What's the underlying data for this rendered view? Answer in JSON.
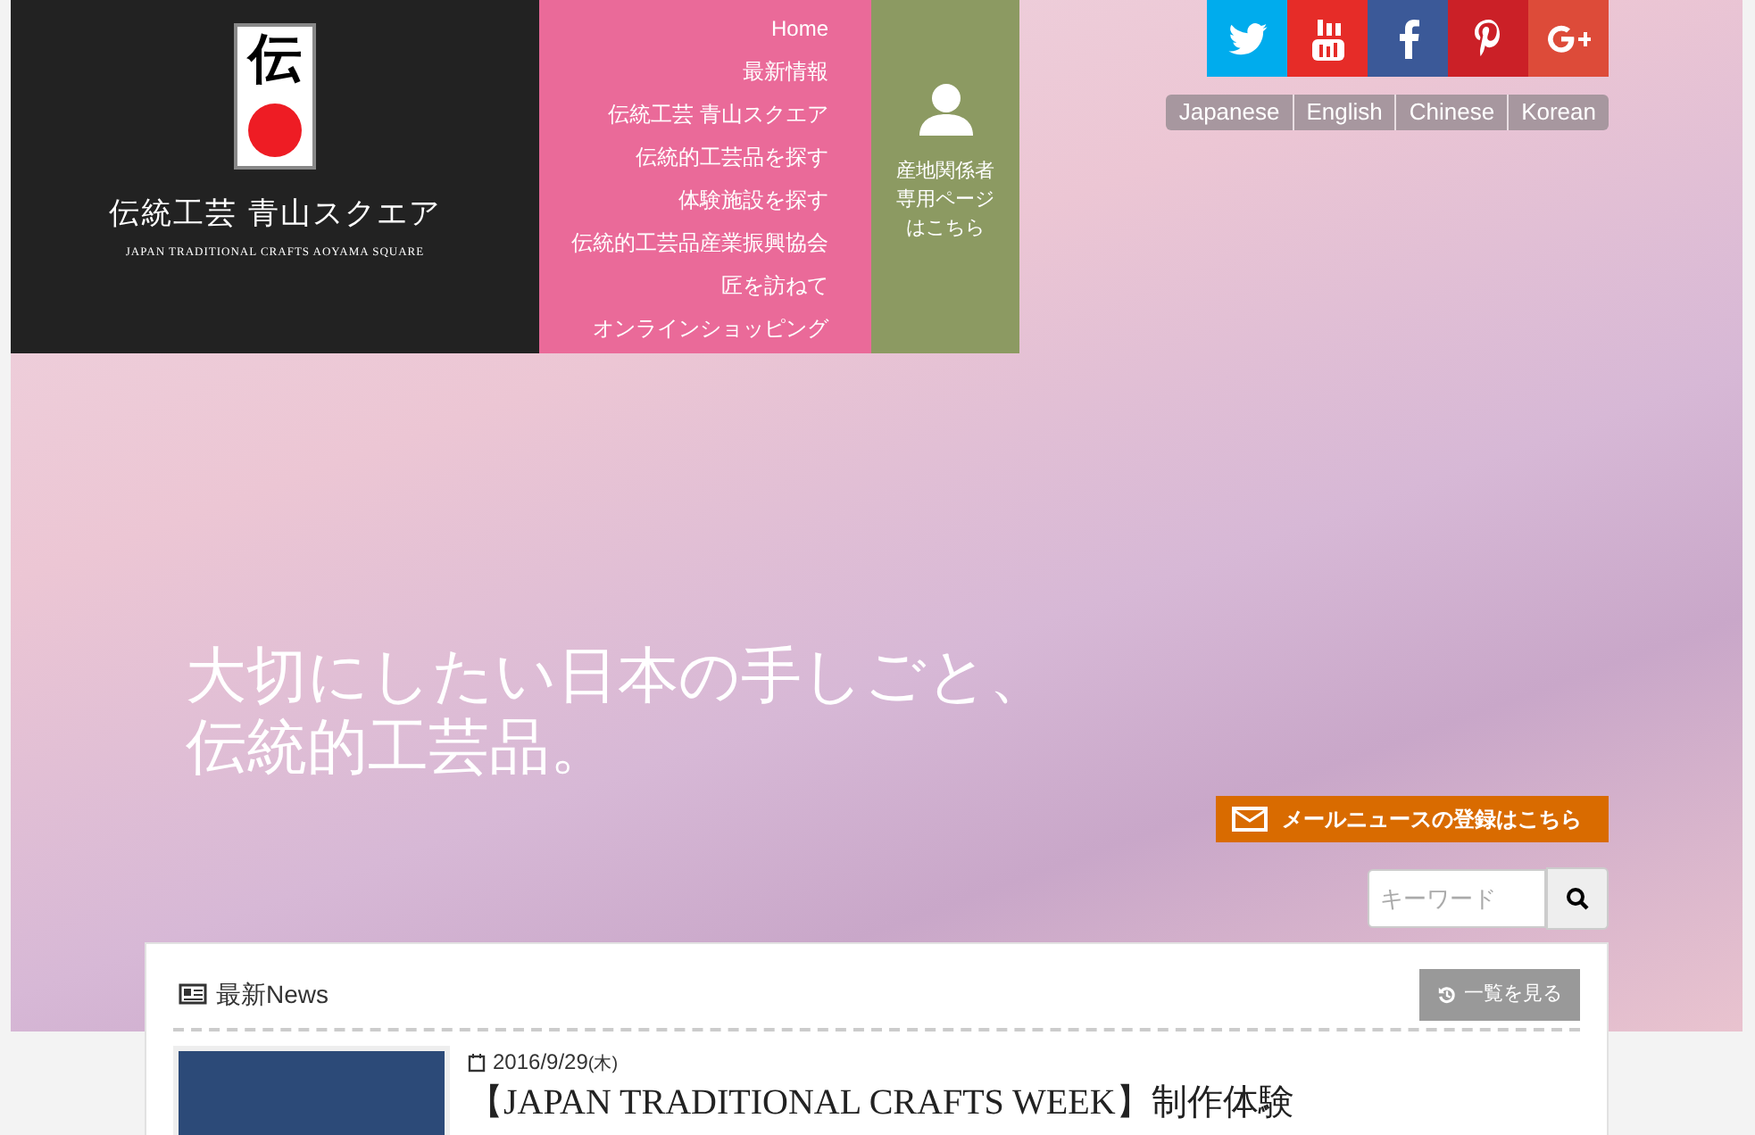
{
  "logo": {
    "mark": "伝",
    "title": "伝統工芸 青山スクエア",
    "subtitle": "JAPAN TRADITIONAL CRAFTS AOYAMA SQUARE"
  },
  "nav": [
    "Home",
    "最新情報",
    "伝統工芸 青山スクエア",
    "伝統的工芸品を探す",
    "体験施設を探す",
    "伝統的工芸品産業振興協会",
    "匠を訪ねて",
    "オンラインショッピング"
  ],
  "producer_link": {
    "lines": [
      "産地関係者",
      "専用ページ",
      "はこちら"
    ]
  },
  "social": [
    {
      "kind": "twitter",
      "color": "#00aced"
    },
    {
      "kind": "youtube",
      "color": "#e62c28"
    },
    {
      "kind": "facebook",
      "color": "#3b5998"
    },
    {
      "kind": "pinterest",
      "color": "#cb2027"
    },
    {
      "kind": "googleplus",
      "color": "#dd4b39"
    }
  ],
  "languages": [
    "Japanese",
    "English",
    "Chinese",
    "Korean"
  ],
  "catchphrase": [
    "大切にしたい日本の手しごと、",
    "伝統的工芸品。"
  ],
  "mail_button": "メールニュースの登録はこちら",
  "search": {
    "placeholder": "キーワード"
  },
  "news": {
    "title": "最新News",
    "more_button": "一覧を見る",
    "items": [
      {
        "date": "2016/9/29",
        "weekday": "(木)",
        "title": "【JAPAN TRADITIONAL CRAFTS WEEK】制作体験"
      }
    ]
  }
}
